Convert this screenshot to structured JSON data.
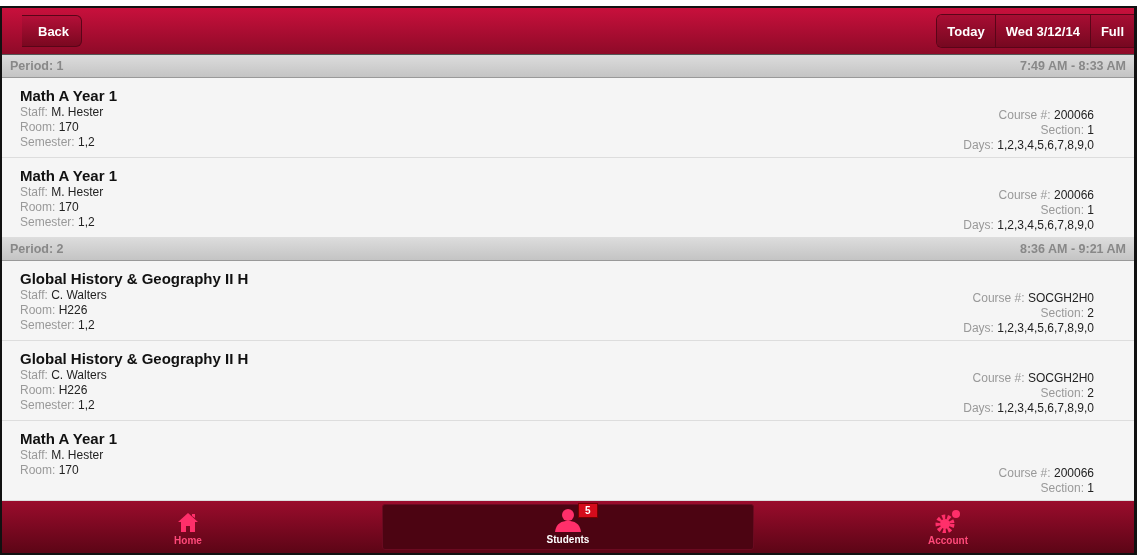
{
  "header": {
    "back": "Back",
    "segments": [
      "Today",
      "Wed 3/12/14",
      "Full"
    ]
  },
  "periods": [
    {
      "label": "Period: 1",
      "time": "7:49 AM - 8:33 AM",
      "courses": [
        {
          "title": "Math A Year 1",
          "left": [
            {
              "label": "Staff:",
              "value": "M. Hester"
            },
            {
              "label": "Room:",
              "value": "170"
            },
            {
              "label": "Semester:",
              "value": "1,2"
            }
          ],
          "right": [
            {
              "label": "Course #:",
              "value": "200066"
            },
            {
              "label": "Section:",
              "value": "1"
            },
            {
              "label": "Days:",
              "value": "1,2,3,4,5,6,7,8,9,0"
            }
          ]
        },
        {
          "title": "Math A Year 1",
          "left": [
            {
              "label": "Staff:",
              "value": "M. Hester"
            },
            {
              "label": "Room:",
              "value": "170"
            },
            {
              "label": "Semester:",
              "value": "1,2"
            }
          ],
          "right": [
            {
              "label": "Course #:",
              "value": "200066"
            },
            {
              "label": "Section:",
              "value": "1"
            },
            {
              "label": "Days:",
              "value": "1,2,3,4,5,6,7,8,9,0"
            }
          ]
        }
      ]
    },
    {
      "label": "Period: 2",
      "time": "8:36 AM - 9:21 AM",
      "courses": [
        {
          "title": "Global History & Geography II H",
          "left": [
            {
              "label": "Staff:",
              "value": "C. Walters"
            },
            {
              "label": "Room:",
              "value": "H226"
            },
            {
              "label": "Semester:",
              "value": "1,2"
            }
          ],
          "right": [
            {
              "label": "Course #:",
              "value": "SOCGH2H0"
            },
            {
              "label": "Section:",
              "value": "2"
            },
            {
              "label": "Days:",
              "value": "1,2,3,4,5,6,7,8,9,0"
            }
          ]
        },
        {
          "title": "Global History & Geography II H",
          "left": [
            {
              "label": "Staff:",
              "value": "C. Walters"
            },
            {
              "label": "Room:",
              "value": "H226"
            },
            {
              "label": "Semester:",
              "value": "1,2"
            }
          ],
          "right": [
            {
              "label": "Course #:",
              "value": "SOCGH2H0"
            },
            {
              "label": "Section:",
              "value": "2"
            },
            {
              "label": "Days:",
              "value": "1,2,3,4,5,6,7,8,9,0"
            }
          ]
        },
        {
          "title": "Math A Year 1",
          "left": [
            {
              "label": "Staff:",
              "value": "M. Hester"
            },
            {
              "label": "Room:",
              "value": "170"
            }
          ],
          "right": [
            {
              "label": "Course #:",
              "value": "200066"
            },
            {
              "label": "Section:",
              "value": "1"
            }
          ]
        }
      ]
    }
  ],
  "nav": [
    {
      "kind": "home",
      "label": "Home",
      "selected": false
    },
    {
      "kind": "students",
      "label": "Students",
      "selected": true,
      "badge": "5"
    },
    {
      "kind": "account",
      "label": "Account",
      "selected": false
    }
  ]
}
